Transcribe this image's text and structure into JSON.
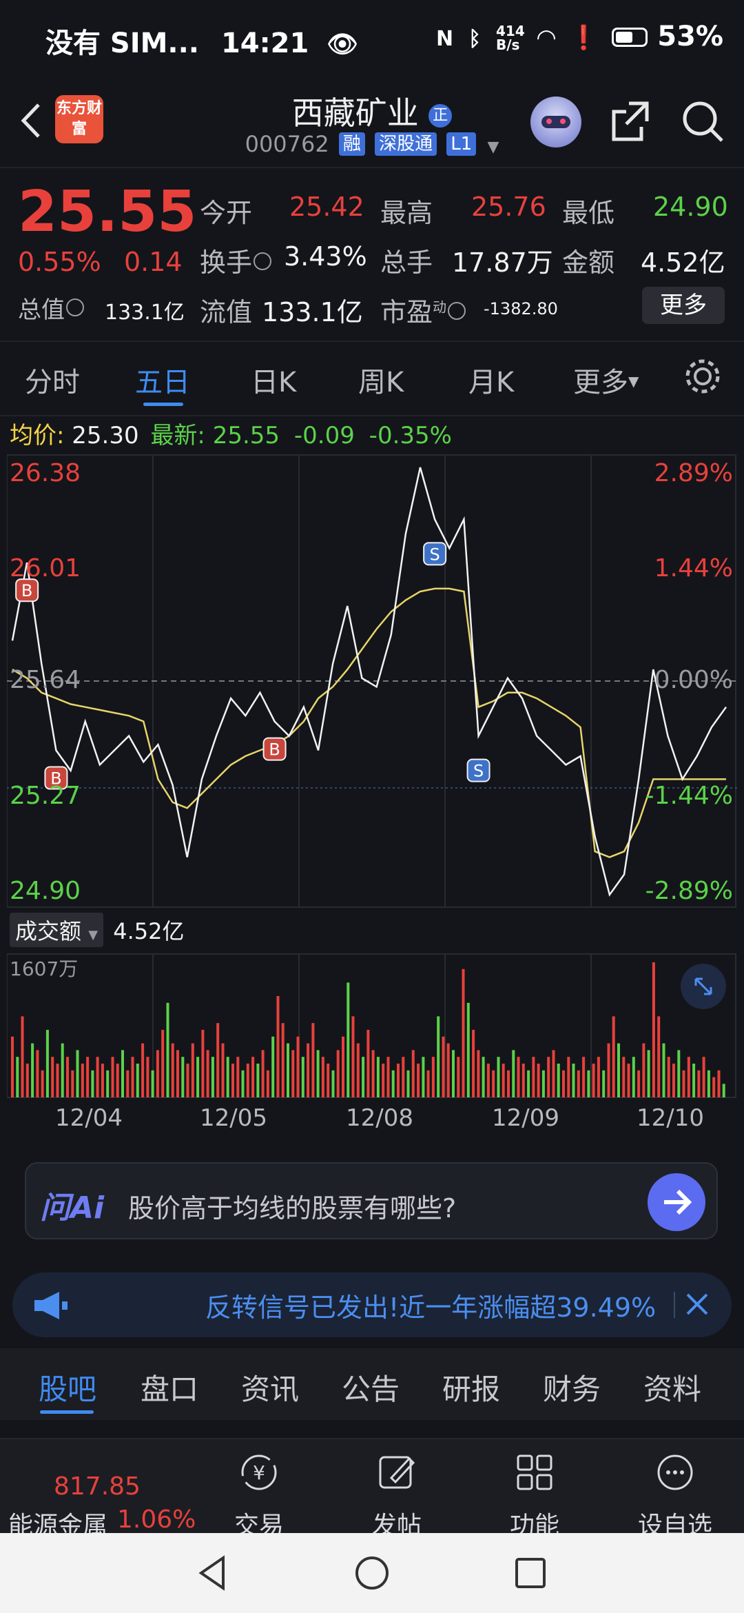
{
  "status_bar": {
    "carrier": "没有 SIM...",
    "time": "14:21",
    "net_speed": "414 B/s",
    "battery": "53%"
  },
  "header": {
    "logo_text": "东方财富",
    "stock_name": "西藏矿业",
    "badge": "正",
    "stock_code": "000762",
    "tags": [
      "融",
      "深股通",
      "L1"
    ]
  },
  "quote": {
    "price": "25.55",
    "change_pct": "0.55%",
    "change": "0.14",
    "fields": {
      "open_label": "今开",
      "open": "25.42",
      "high_label": "最高",
      "high": "25.76",
      "low_label": "最低",
      "low": "24.90",
      "turnover_label": "换手",
      "turnover": "3.43%",
      "volume_label": "总手",
      "volume": "17.87万",
      "amount_label": "金额",
      "amount": "4.52亿",
      "mktcap_label": "总值",
      "mktcap": "133.1亿",
      "float_label": "流值",
      "float": "133.1亿",
      "pe_label": "市盈",
      "pe_sup": "动",
      "pe": "-1382.80"
    },
    "more_label": "更多"
  },
  "tabs": [
    "分时",
    "五日",
    "日K",
    "周K",
    "月K",
    "更多"
  ],
  "active_tab": "五日",
  "avg_row": {
    "avg_label": "均价:",
    "avg": "25.30",
    "latest_label": "最新:",
    "latest": "25.55",
    "chg": "-0.09",
    "chg_pct": "-0.35%"
  },
  "chart_data": {
    "type": "line",
    "title": "",
    "y_left_ticks": [
      "26.38",
      "26.01",
      "25.64",
      "25.27",
      "24.90"
    ],
    "y_right_ticks": [
      "2.89%",
      "1.44%",
      "0.00%",
      "-1.44%",
      "-2.89%"
    ],
    "ylim": [
      24.9,
      26.38
    ],
    "x": [
      "12/04",
      "12/05",
      "12/08",
      "12/09",
      "12/10"
    ],
    "series": [
      {
        "name": "",
        "values": [
          25.78,
          26.05,
          25.7,
          25.4,
          25.33,
          25.5,
          25.35,
          25.4,
          25.45,
          25.36,
          25.42,
          25.28,
          25.03,
          25.3,
          25.45,
          25.58,
          25.52,
          25.6,
          25.5,
          25.45,
          25.55,
          25.4,
          25.7,
          25.9,
          25.65,
          25.62,
          25.8,
          26.15,
          26.38,
          26.2,
          26.1,
          26.2,
          25.45,
          25.55,
          25.65,
          25.58,
          25.45,
          25.4,
          25.35,
          25.38,
          25.1,
          24.9,
          24.97,
          25.3,
          25.68,
          25.45,
          25.3,
          25.38,
          25.48,
          25.55
        ]
      },
      {
        "name": "",
        "values": [
          25.68,
          25.65,
          25.6,
          25.58,
          25.56,
          25.55,
          25.54,
          25.53,
          25.52,
          25.5,
          25.3,
          25.22,
          25.2,
          25.25,
          25.3,
          25.35,
          25.38,
          25.4,
          25.42,
          25.45,
          25.5,
          25.58,
          25.62,
          25.68,
          25.75,
          25.82,
          25.88,
          25.92,
          25.95,
          25.96,
          25.96,
          25.95,
          25.55,
          25.57,
          25.6,
          25.6,
          25.58,
          25.55,
          25.52,
          25.48,
          25.05,
          25.03,
          25.05,
          25.15,
          25.3,
          25.3,
          25.3,
          25.3,
          25.3,
          25.3
        ]
      }
    ],
    "markers": [
      "B",
      "B",
      "B",
      "S",
      "S"
    ]
  },
  "volume": {
    "selector": "成交额",
    "total": "4.52亿",
    "max_label": "1607万",
    "values": [
      0.45,
      0.3,
      0.6,
      0.25,
      0.4,
      0.35,
      0.2,
      0.5,
      0.3,
      0.25,
      0.4,
      0.3,
      0.2,
      0.35,
      0.25,
      0.3,
      0.2,
      0.3,
      0.25,
      0.2,
      0.3,
      0.25,
      0.35,
      0.2,
      0.3,
      0.25,
      0.4,
      0.3,
      0.2,
      0.35,
      0.5,
      0.7,
      0.4,
      0.35,
      0.3,
      0.25,
      0.4,
      0.3,
      0.5,
      0.35,
      0.3,
      0.55,
      0.4,
      0.3,
      0.25,
      0.3,
      0.2,
      0.25,
      0.3,
      0.25,
      0.35,
      0.2,
      0.45,
      0.75,
      0.55,
      0.4,
      0.35,
      0.45,
      0.3,
      0.4,
      0.55,
      0.35,
      0.3,
      0.25,
      0.2,
      0.35,
      0.45,
      0.85,
      0.6,
      0.4,
      0.3,
      0.5,
      0.35,
      0.3,
      0.25,
      0.3,
      0.2,
      0.25,
      0.3,
      0.2,
      0.35,
      0.25,
      0.3,
      0.2,
      0.3,
      0.6,
      0.45,
      0.4,
      0.35,
      0.3,
      0.95,
      0.7,
      0.5,
      0.35,
      0.3,
      0.25,
      0.2,
      0.3,
      0.25,
      0.2,
      0.35,
      0.3,
      0.25,
      0.2,
      0.3,
      0.25,
      0.2,
      0.3,
      0.35,
      0.25,
      0.2,
      0.3,
      0.25,
      0.2,
      0.3,
      0.2,
      0.25,
      0.3,
      0.2,
      0.4,
      0.6,
      0.4,
      0.3,
      0.25,
      0.3,
      0.2,
      0.4,
      0.35,
      1.0,
      0.6,
      0.4,
      0.3,
      0.25,
      0.35,
      0.2,
      0.3,
      0.25,
      0.2,
      0.3,
      0.2,
      0.15,
      0.2,
      0.1
    ],
    "dates": [
      "12/04",
      "12/05",
      "12/08",
      "12/09",
      "12/10"
    ]
  },
  "ai_bar": {
    "logo": "问Ai",
    "placeholder": "股价高于均线的股票有哪些?"
  },
  "banner": {
    "text": "反转信号已发出!近一年涨幅超39.49%"
  },
  "bottom_tabs": [
    "股吧",
    "盘口",
    "资讯",
    "公告",
    "研报",
    "财务",
    "资料"
  ],
  "toolbar": {
    "index_value": "817.85",
    "index_name": "能源金属",
    "index_pct": "1.06%",
    "items": [
      "交易",
      "发帖",
      "功能",
      "设自选"
    ]
  },
  "colors": {
    "up": "#e8413c",
    "down": "#5bd24a",
    "accent": "#3f8bf2",
    "avg_line": "#e7d56a"
  }
}
